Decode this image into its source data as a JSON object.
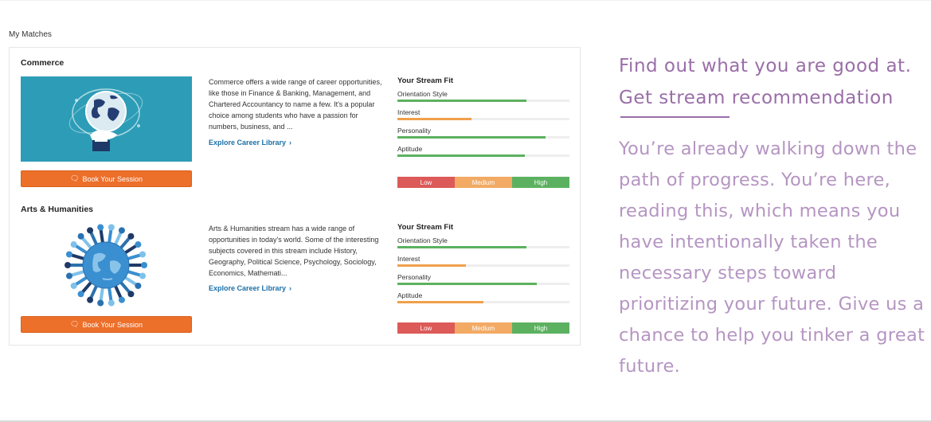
{
  "section_label": "My Matches",
  "streams": [
    {
      "title": "Commerce",
      "image": "globe-in-hand-illustration",
      "description": "Commerce offers a wide range of career opportunities, like those in Finance & Banking, Management, and Chartered Accountancy to name a few. It's a popular choice among students who have a passion for numbers, business, and ...",
      "explore_label": "Explore Career Library",
      "book_label": "Book Your Session",
      "fit": {
        "title": "Your Stream Fit",
        "rows": [
          {
            "label": "Orientation Style",
            "level": 0.75,
            "color": "green"
          },
          {
            "label": "Interest",
            "level": 0.43,
            "color": "orange"
          },
          {
            "label": "Personality",
            "level": 0.86,
            "color": "green"
          },
          {
            "label": "Aptitude",
            "level": 0.74,
            "color": "green"
          }
        ]
      },
      "legend": [
        "Low",
        "Medium",
        "High"
      ]
    },
    {
      "title": "Arts & Humanities",
      "image": "globe-with-hands-illustration",
      "description": "Arts & Humanities stream has a wide range of opportunities in today's world. Some of the interesting subjects covered in this stream include History, Geography, Political Science, Psychology, Sociology, Economics, Mathemati...",
      "explore_label": "Explore Career Library",
      "book_label": "Book Your Session",
      "fit": {
        "title": "Your Stream Fit",
        "rows": [
          {
            "label": "Orientation Style",
            "level": 0.75,
            "color": "green"
          },
          {
            "label": "Interest",
            "level": 0.4,
            "color": "orange"
          },
          {
            "label": "Personality",
            "level": 0.81,
            "color": "green"
          },
          {
            "label": "Aptitude",
            "level": 0.5,
            "color": "orange"
          }
        ]
      },
      "legend": [
        "Low",
        "Medium",
        "High"
      ]
    }
  ],
  "promo": {
    "heading_line1": "Find out what you are good at.",
    "heading_line2": "Get stream recommendation",
    "body": "You’re already walking down the path of progress. You’re here, reading this, which means you have intentionally taken the necessary steps toward prioritizing your future. Give us a chance to help you tinker a  great future."
  },
  "colors": {
    "accent_purple": "#9a6ea8",
    "button_orange": "#ec6f2a",
    "bar_green": "#5cb160",
    "bar_orange": "#f0a04b",
    "link_blue": "#1b6fa8"
  }
}
